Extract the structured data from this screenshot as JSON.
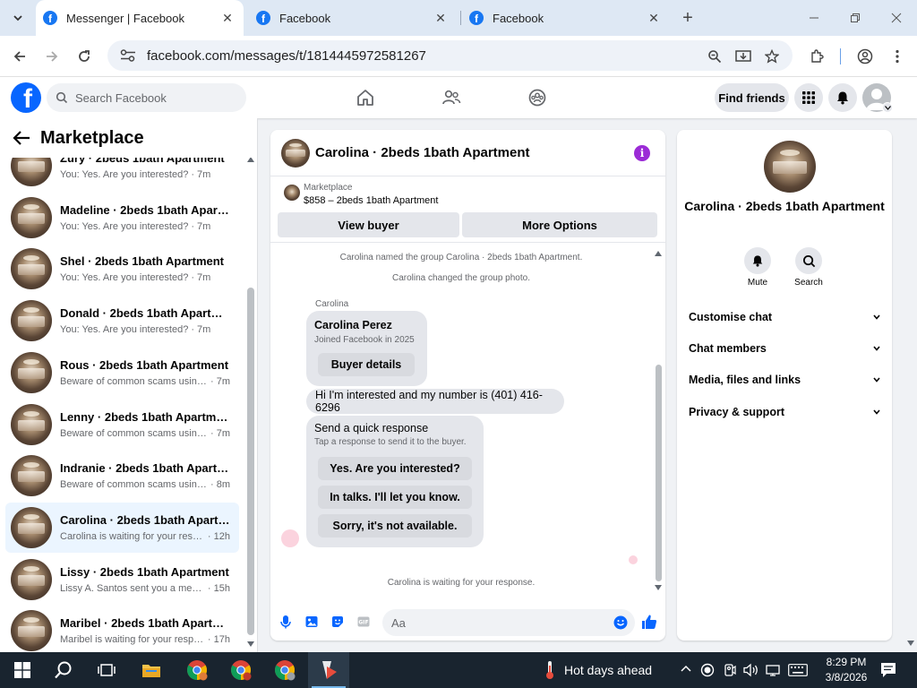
{
  "browser": {
    "tabs": [
      {
        "title": "Messenger | Facebook",
        "active": true
      },
      {
        "title": "Facebook",
        "active": false
      },
      {
        "title": "Facebook",
        "active": false
      }
    ],
    "url": "facebook.com/messages/t/1814445972581267"
  },
  "fb_header": {
    "search_placeholder": "Search Facebook",
    "find_friends_label": "Find friends"
  },
  "sidebar": {
    "title": "Marketplace",
    "conversations": [
      {
        "name": "Zury · 2beds 1bath Apartment",
        "preview": "You: Yes. Are you interested?",
        "time": "· 7m",
        "selected": false
      },
      {
        "name": "Madeline · 2beds 1bath Apartm...",
        "preview": "You: Yes. Are you interested?",
        "time": "· 7m",
        "selected": false
      },
      {
        "name": "Shel · 2beds 1bath Apartment",
        "preview": "You: Yes. Are you interested?",
        "time": "· 7m",
        "selected": false
      },
      {
        "name": "Donald · 2beds 1bath Apartment",
        "preview": "You: Yes. Are you interested?",
        "time": "· 7m",
        "selected": false
      },
      {
        "name": "Rous · 2beds 1bath Apartment",
        "preview": "Beware of common scams using ...",
        "time": "· 7m",
        "selected": false
      },
      {
        "name": "Lenny · 2beds 1bath Apartment",
        "preview": "Beware of common scams using ...",
        "time": "· 7m",
        "selected": false
      },
      {
        "name": "Indranie · 2beds 1bath Apartment",
        "preview": "Beware of common scams using ...",
        "time": "· 8m",
        "selected": false
      },
      {
        "name": "Carolina · 2beds 1bath Apartment",
        "preview": "Carolina is waiting for your respo...",
        "time": "· 12h",
        "selected": true
      },
      {
        "name": "Lissy · 2beds 1bath Apartment",
        "preview": "Lissy A. Santos sent you a messag...",
        "time": "· 15h",
        "selected": false
      },
      {
        "name": "Maribel · 2beds 1bath Apartment",
        "preview": "Maribel is waiting for your respo...",
        "time": "· 17h",
        "selected": false
      }
    ]
  },
  "chat": {
    "title": "Carolina · 2beds 1bath Apartment",
    "marketplace_label": "Marketplace",
    "listing": "$858 – 2beds 1bath Apartment",
    "view_buyer_label": "View buyer",
    "more_options_label": "More Options",
    "system_messages": [
      "Carolina named the group Carolina · 2beds 1bath Apartment.",
      "Carolina changed the group photo."
    ],
    "sender_name": "Carolina",
    "profile_card": {
      "name": "Carolina Perez",
      "joined": "Joined Facebook in 2025",
      "button": "Buyer details"
    },
    "message": "Hi I'm interested and my number is (401) 416-6296",
    "quick_response": {
      "title": "Send a quick response",
      "subtitle": "Tap a response to send it to the buyer.",
      "options": [
        "Yes. Are you interested?",
        "In talks. I'll let you know.",
        "Sorry, it's not available."
      ]
    },
    "waiting_text": "Carolina is waiting for your response.",
    "input_placeholder": "Aa"
  },
  "info_panel": {
    "name": "Carolina · 2beds 1bath Apartment",
    "actions": [
      {
        "label": "Mute",
        "icon": "bell-icon"
      },
      {
        "label": "Search",
        "icon": "search-icon"
      }
    ],
    "sections": [
      "Customise chat",
      "Chat members",
      "Media, files and links",
      "Privacy & support"
    ]
  },
  "taskbar": {
    "weather": "Hot days ahead",
    "time": "8:29 PM",
    "date": "3/8/2026"
  },
  "colors": {
    "fb_blue": "#0866ff",
    "selected_row": "#ebf5ff",
    "taskbar": "#19242f",
    "info_icon": "#9b2bd6"
  }
}
